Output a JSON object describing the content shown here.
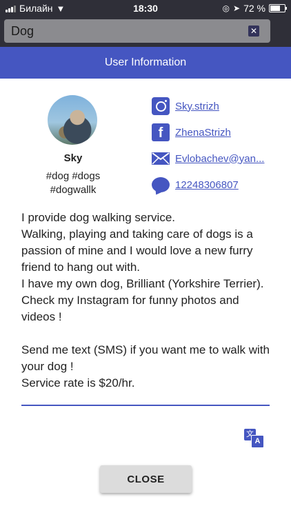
{
  "status_bar": {
    "carrier": "Билайн",
    "time": "18:30",
    "battery": "72 %",
    "battery_level": 0.72
  },
  "search": {
    "value": "Dog",
    "clear_icon": "close-icon"
  },
  "header": {
    "title": "User Information"
  },
  "profile": {
    "name": "Sky",
    "tags": "#dog #dogs\n#dogwallk"
  },
  "contacts": [
    {
      "icon": "instagram-icon",
      "text": "Sky.strizh"
    },
    {
      "icon": "facebook-icon",
      "text": "ZhenaStrizh"
    },
    {
      "icon": "email-icon",
      "text": "Evlobachev@yan..."
    },
    {
      "icon": "sms-icon",
      "text": "12248306807"
    }
  ],
  "description": "I provide dog walking service.\nWalking, playing and taking care of dogs is a passion of mine and I would love a new furry friend to hang out with.\nI have my own dog, Brilliant (Yorkshire Terrier). Check my Instagram for funny photos and videos !\n\nSend me text (SMS) if you want me to walk with your dog !\nService rate is $20/hr.",
  "translate_icon": "translate-icon",
  "close_label": "CLOSE",
  "colors": {
    "accent": "#4556c1",
    "status_bg": "#2f2f38",
    "button_bg": "#dcdcdc"
  }
}
